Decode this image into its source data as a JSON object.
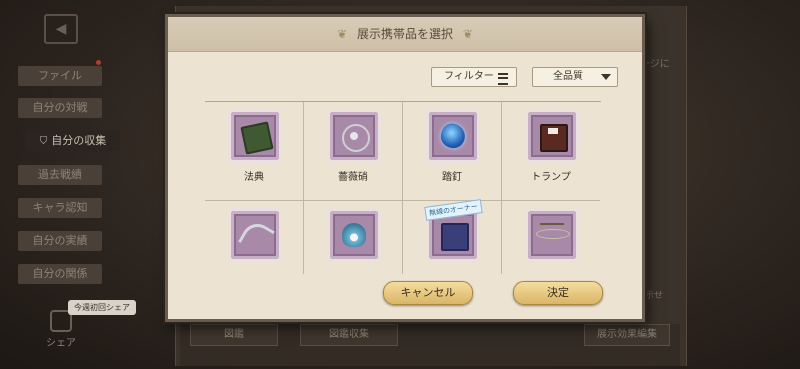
{
  "background": {
    "sidebar": {
      "items": [
        {
          "label": "ファイル"
        },
        {
          "label": "自分の対戦"
        },
        {
          "label": "自分の収集"
        },
        {
          "label": "過去戦績"
        },
        {
          "label": "キャラ認知"
        },
        {
          "label": "自分の実績"
        },
        {
          "label": "自分の関係"
        }
      ],
      "share_pill": "今週初回シェア",
      "share_label": "シェア"
    },
    "right_text_top": "ージに",
    "right_text_bottom": "表示せ",
    "bottom_buttons": [
      "図鑑",
      "図鑑収集",
      "展示効果編集"
    ]
  },
  "dialog": {
    "title": "展示携帯品を選択",
    "filter_label": "フィルター",
    "rank_selected": "全品質",
    "items": [
      {
        "name": "法典",
        "icon": "book-icon"
      },
      {
        "name": "薔薇硝",
        "icon": "rose-chain-icon"
      },
      {
        "name": "踏釘",
        "icon": "blue-gem-icon"
      },
      {
        "name": "トランプ",
        "icon": "playing-cards-icon"
      },
      {
        "name": "",
        "icon": "silver-ornament-icon"
      },
      {
        "name": "",
        "icon": "seashell-icon"
      },
      {
        "name": "",
        "icon": "tome-icon",
        "tag": "無線のオーナー"
      },
      {
        "name": "",
        "icon": "dragonfly-icon"
      }
    ],
    "cancel_label": "キャンセル",
    "ok_label": "決定"
  }
}
